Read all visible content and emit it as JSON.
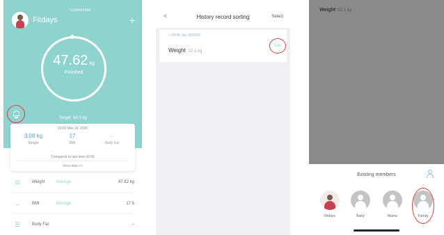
{
  "colors": {
    "teal": "#8fd3cf",
    "blue": "#4fa3d1",
    "red_annotation": "#e53b3b",
    "overlay_gray": "#8a8a8a"
  },
  "home": {
    "username": "Fitdays",
    "connection": "Connected",
    "add_icon": "plus-icon",
    "weight_value": "47.62",
    "weight_unit": "kg",
    "status": "Finished",
    "target": "Target: 50.0 kg",
    "card": {
      "date": "16:00 Mar 16, 2020",
      "stats": [
        {
          "value": "3.08 kg",
          "label": "Weight"
        },
        {
          "value": "17",
          "label": "BMI"
        },
        {
          "value": "--",
          "label": "Body Fat"
        }
      ],
      "compare": "Compared to last time 09:06",
      "view": "View data >>"
    },
    "metrics": [
      {
        "icon": "scale-icon",
        "name": "Weight",
        "tag": "Average",
        "value": "47.62 kg"
      },
      {
        "icon": "bmi-icon",
        "name": "BMI",
        "tag": "Average",
        "value": "17.5"
      },
      {
        "icon": "body-fat-icon",
        "name": "Body Fat",
        "tag": "",
        "value": "--"
      }
    ]
  },
  "history": {
    "back_icon": "back-chevron-icon",
    "title": "History record sorting",
    "select_label": "Select",
    "record": {
      "date": "09:06 Jan 16/2020",
      "metric": "Weight",
      "value": "52.1 kg",
      "user_label": "User"
    }
  },
  "members": {
    "overlay_title": "Weight",
    "overlay_value": "52.1 kg",
    "sheet_title": "Existing members",
    "list": [
      {
        "name": "Fitdays",
        "avatar": "fitdays"
      },
      {
        "name": "Baby",
        "avatar": "default"
      },
      {
        "name": "Mama",
        "avatar": "default"
      },
      {
        "name": "Family",
        "avatar": "default"
      }
    ]
  }
}
